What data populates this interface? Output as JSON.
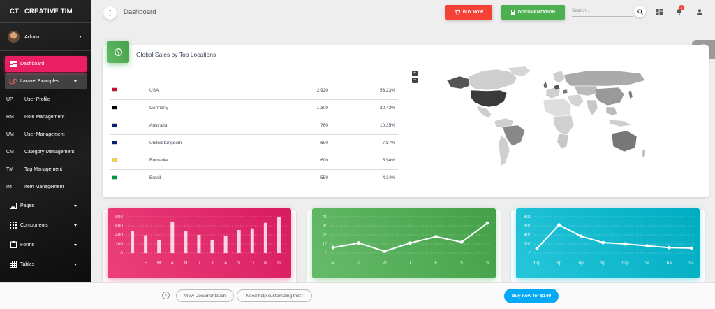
{
  "sidebar": {
    "logo_mini": "CT",
    "logo_text": "CREATIVE TIM",
    "user_name": "Admin",
    "items": [
      {
        "label": "Dashboard",
        "icon": "dashboard-icon"
      },
      {
        "label": "Laravel Examples",
        "icon": "laravel-icon"
      }
    ],
    "sub_items": [
      {
        "abbr": "UP",
        "label": "User Profile"
      },
      {
        "abbr": "RM",
        "label": "Role Management"
      },
      {
        "abbr": "UM",
        "label": "User Management"
      },
      {
        "abbr": "CM",
        "label": "Category Management"
      },
      {
        "abbr": "TM",
        "label": "Tag Management"
      },
      {
        "abbr": "IM",
        "label": "Item Management"
      }
    ],
    "sections": [
      {
        "label": "Pages",
        "icon": "image-icon"
      },
      {
        "label": "Components",
        "icon": "apps-icon"
      },
      {
        "label": "Forms",
        "icon": "clipboard-icon"
      },
      {
        "label": "Tables",
        "icon": "grid-icon"
      }
    ]
  },
  "topbar": {
    "title": "Dashboard",
    "buy_label": "BUY NOW",
    "docs_label": "DOCUMENTATION",
    "search_placeholder": "Search...",
    "notification_count": "5"
  },
  "sales_card": {
    "title": "Global Sales by Top Locations",
    "rows": [
      {
        "country": "USA",
        "sales": "2.920",
        "percent": "53.23%",
        "flag_color": "#c8102e"
      },
      {
        "country": "Germany",
        "sales": "1.300",
        "percent": "20.43%",
        "flag_color": "#000000"
      },
      {
        "country": "Australia",
        "sales": "760",
        "percent": "10.35%",
        "flag_color": "#012169"
      },
      {
        "country": "United Kingdom",
        "sales": "690",
        "percent": "7.87%",
        "flag_color": "#012169"
      },
      {
        "country": "Romania",
        "sales": "600",
        "percent": "5.94%",
        "flag_color": "#fcd116"
      },
      {
        "country": "Brasil",
        "sales": "550",
        "percent": "4.34%",
        "flag_color": "#009c3b"
      }
    ],
    "zoom_in": "+",
    "zoom_out": "−"
  },
  "chart_data": [
    {
      "type": "bar",
      "color": "#e91e63",
      "categories": [
        "J",
        "F",
        "M",
        "A",
        "M",
        "J",
        "J",
        "A",
        "S",
        "O",
        "N",
        "D"
      ],
      "values": [
        540,
        440,
        320,
        780,
        550,
        450,
        330,
        430,
        570,
        610,
        750,
        900
      ],
      "ylim": [
        0,
        900
      ],
      "yticks": [
        "0",
        "200",
        "400",
        "600",
        "800"
      ]
    },
    {
      "type": "line",
      "color": "#4caf50",
      "categories": [
        "M",
        "T",
        "W",
        "T",
        "F",
        "S",
        "S"
      ],
      "values": [
        6,
        11,
        2,
        11,
        18,
        12,
        33
      ],
      "ylim": [
        0,
        40
      ],
      "yticks": [
        "0",
        "10",
        "20",
        "30",
        "40"
      ]
    },
    {
      "type": "line",
      "color": "#00bcd4",
      "categories": [
        "12p",
        "3p",
        "6p",
        "9p",
        "12p",
        "3a",
        "6a",
        "9a"
      ],
      "values": [
        100,
        620,
        370,
        230,
        200,
        160,
        120,
        110
      ],
      "ylim": [
        0,
        800
      ],
      "yticks": [
        "0",
        "200",
        "400",
        "600",
        "800"
      ]
    }
  ],
  "footer": {
    "view_docs": "View Documentation",
    "help": "Need help customizing this?",
    "buy": "Buy now for $149",
    "close": "×"
  }
}
